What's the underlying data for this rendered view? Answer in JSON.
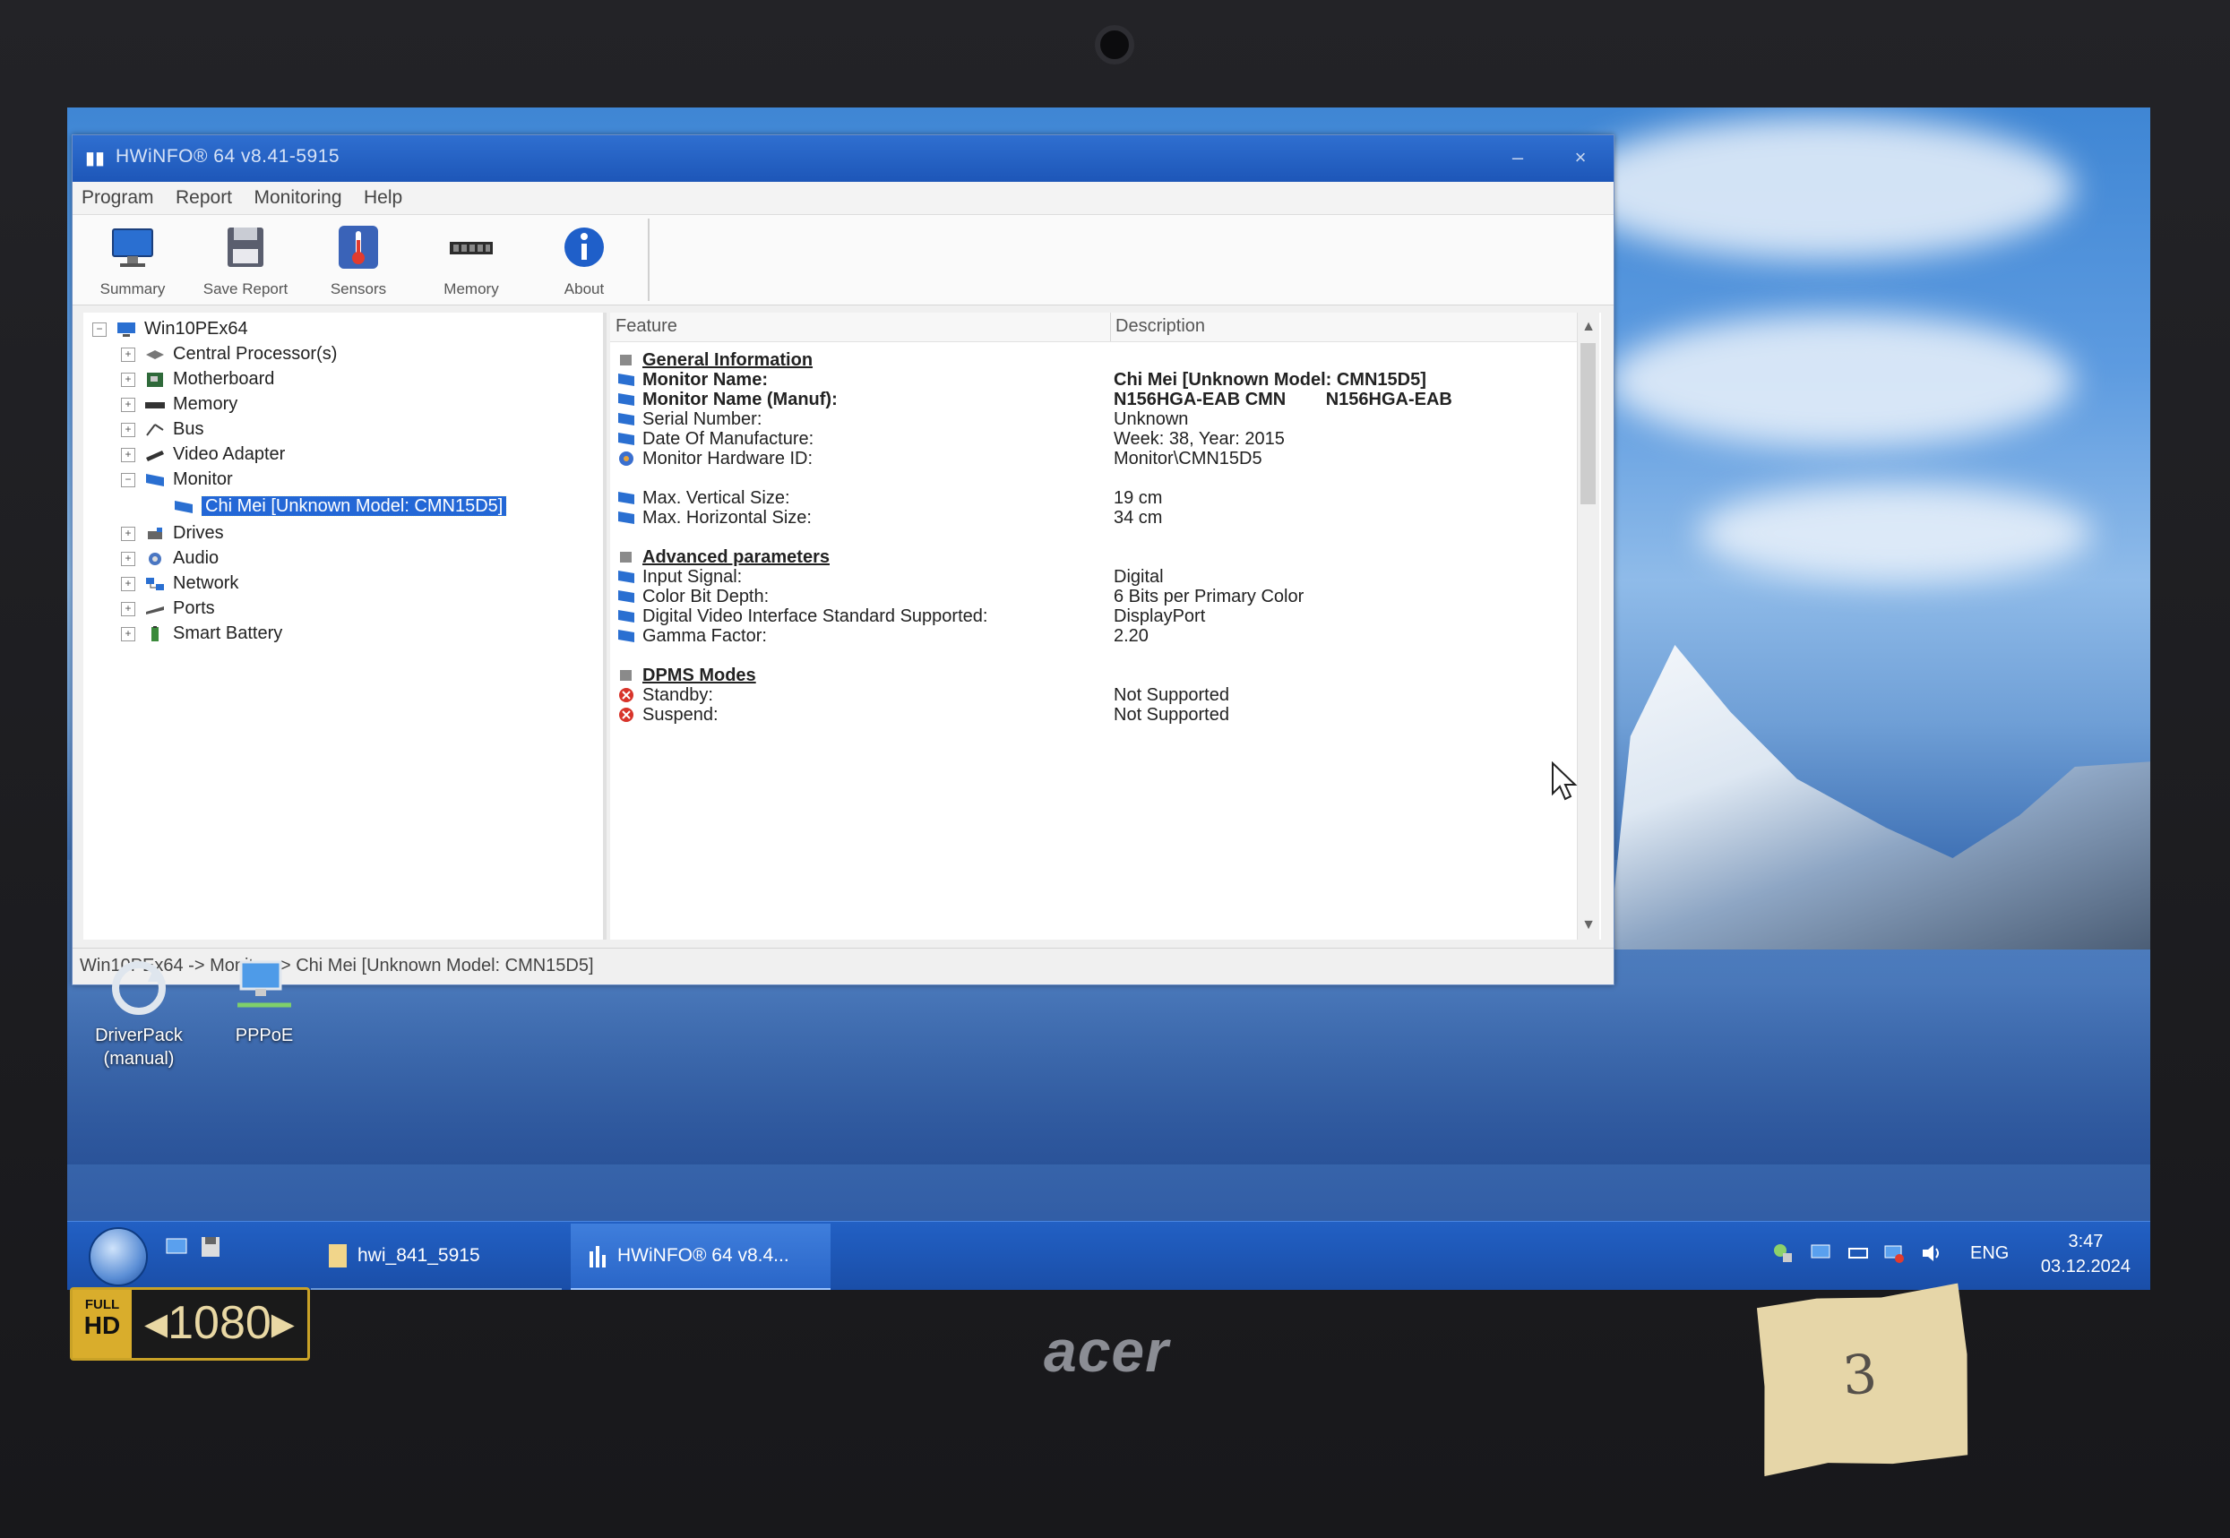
{
  "window": {
    "title": "HWiNFO® 64 v8.41-5915",
    "menu": [
      "Program",
      "Report",
      "Monitoring",
      "Help"
    ],
    "toolbar": [
      {
        "label": "Summary",
        "icon": "monitor-icon"
      },
      {
        "label": "Save Report",
        "icon": "floppy-icon"
      },
      {
        "label": "Sensors",
        "icon": "thermometer-icon"
      },
      {
        "label": "Memory",
        "icon": "ram-icon"
      },
      {
        "label": "About",
        "icon": "info-icon"
      }
    ]
  },
  "tree": {
    "root": "Win10PEx64",
    "items": [
      {
        "label": "Central Processor(s)",
        "icon": "cpu-icon"
      },
      {
        "label": "Motherboard",
        "icon": "motherboard-icon"
      },
      {
        "label": "Memory",
        "icon": "ram-icon"
      },
      {
        "label": "Bus",
        "icon": "bus-icon"
      },
      {
        "label": "Video Adapter",
        "icon": "video-card-icon"
      },
      {
        "label": "Monitor",
        "icon": "monitor-icon"
      },
      {
        "label": "Chi Mei [Unknown Model: CMN15D5]",
        "icon": "monitor-icon"
      },
      {
        "label": "Drives",
        "icon": "drive-icon"
      },
      {
        "label": "Audio",
        "icon": "speaker-icon"
      },
      {
        "label": "Network",
        "icon": "network-icon"
      },
      {
        "label": "Ports",
        "icon": "port-icon"
      },
      {
        "label": "Smart Battery",
        "icon": "battery-icon"
      }
    ]
  },
  "grid": {
    "headers": {
      "feature": "Feature",
      "description": "Description"
    },
    "rows": [
      {
        "feature": "General Information",
        "description": ""
      },
      {
        "feature": "Monitor Name:",
        "description": "Chi Mei [Unknown Model: CMN15D5]"
      },
      {
        "feature": "Monitor Name (Manuf):",
        "description": "N156HGA-EAB CMN        N156HGA-EAB"
      },
      {
        "feature": "Serial Number:",
        "description": "Unknown"
      },
      {
        "feature": "Date Of Manufacture:",
        "description": "Week: 38, Year: 2015"
      },
      {
        "feature": "Monitor Hardware ID:",
        "description": "Monitor\\CMN15D5"
      },
      {
        "feature": "Max. Vertical Size:",
        "description": "19 cm"
      },
      {
        "feature": "Max. Horizontal Size:",
        "description": "34 cm"
      },
      {
        "feature": "Advanced parameters",
        "description": ""
      },
      {
        "feature": "Input Signal:",
        "description": "Digital"
      },
      {
        "feature": "Color Bit Depth:",
        "description": "6 Bits per Primary Color"
      },
      {
        "feature": "Digital Video Interface Standard Supported:",
        "description": "DisplayPort"
      },
      {
        "feature": "Gamma Factor:",
        "description": "2.20"
      },
      {
        "feature": "DPMS Modes",
        "description": ""
      },
      {
        "feature": "Standby:",
        "description": "Not Supported"
      },
      {
        "feature": "Suspend:",
        "description": "Not Supported"
      }
    ]
  },
  "status": "Win10PEx64 -> Monitor -> Chi Mei [Unknown Model: CMN15D5]",
  "desktop": {
    "icons": [
      "DriverPack\n(manual)",
      "PPPoE"
    ]
  },
  "taskbar": {
    "tasks": [
      "hwi_841_5915",
      "HWiNFO® 64 v8.4..."
    ],
    "language": "ENG",
    "time": "3:47",
    "date": "03.12.2024"
  },
  "bezel": {
    "badge_top": "FULL",
    "badge_hd": "HD",
    "badge_res": "1080",
    "brand": "acer",
    "tape_note": "3"
  },
  "colors": {
    "selection": "#2367d6",
    "titlebar": "#1d56b8",
    "taskbar": "#1a4ea8"
  }
}
